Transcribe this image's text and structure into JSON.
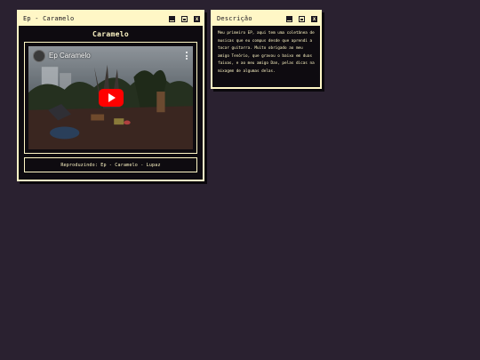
{
  "player_window": {
    "title": "Ep - Caramelo",
    "heading": "Caramelo",
    "video": {
      "title": "Ep Caramelo",
      "play_icon": "youtube-play-icon",
      "menu_icon": "kebab-menu-icon"
    },
    "now_playing": "Reproduzindo: Ep - Caramelo - Lupaz"
  },
  "description_window": {
    "title": "Descrição",
    "text": "Meu primeiro EP, aqui tem uma coletânea de musicas que eu compus desde que aprendi a tocar guitarra. Muito obrigado ao meu amigo Tenório, que gravou o baixo em duas faixas, e ao meu amigo Dan, pelas dicas na mixagem de algumas delas."
  },
  "window_controls": {
    "minimize_icon": "minimize-icon",
    "maximize_icon": "maximize-icon",
    "close_icon": "close-icon"
  },
  "colors": {
    "desktop_bg": "#2a2130",
    "window_accent": "#fff7c6",
    "window_bg": "#0e0b10",
    "play_button": "#ff0000"
  }
}
